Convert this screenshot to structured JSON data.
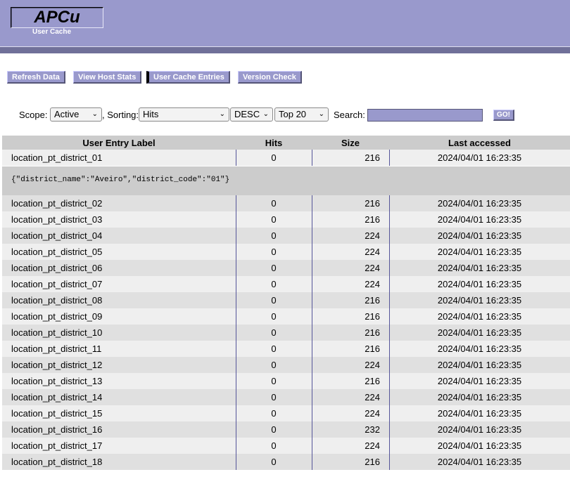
{
  "header": {
    "logo_title": "APCu",
    "logo_subtitle": "User Cache"
  },
  "menu": [
    {
      "label": "Refresh Data"
    },
    {
      "label": "View Host Stats"
    },
    {
      "label": "User Cache Entries"
    },
    {
      "label": "Version Check"
    }
  ],
  "filters": {
    "scope_label": "Scope:",
    "scope_value": "Active",
    "sorting_label": ", Sorting:",
    "sort_value": "Hits",
    "order_value": "DESC",
    "limit_value": "Top 20",
    "search_label": "Search:",
    "search_value": "",
    "go_label": "GO!"
  },
  "table": {
    "headers": [
      "User Entry Label",
      "Hits",
      "Size",
      "Last accessed"
    ],
    "detail": "{\"district_name\":\"Aveiro\",\"district_code\":\"01\"}",
    "rows": [
      [
        "location_pt_district_01",
        "0",
        "216",
        "2024/04/01 16:23:35"
      ],
      [
        "location_pt_district_02",
        "0",
        "216",
        "2024/04/01 16:23:35"
      ],
      [
        "location_pt_district_03",
        "0",
        "216",
        "2024/04/01 16:23:35"
      ],
      [
        "location_pt_district_04",
        "0",
        "224",
        "2024/04/01 16:23:35"
      ],
      [
        "location_pt_district_05",
        "0",
        "224",
        "2024/04/01 16:23:35"
      ],
      [
        "location_pt_district_06",
        "0",
        "224",
        "2024/04/01 16:23:35"
      ],
      [
        "location_pt_district_07",
        "0",
        "224",
        "2024/04/01 16:23:35"
      ],
      [
        "location_pt_district_08",
        "0",
        "216",
        "2024/04/01 16:23:35"
      ],
      [
        "location_pt_district_09",
        "0",
        "216",
        "2024/04/01 16:23:35"
      ],
      [
        "location_pt_district_10",
        "0",
        "216",
        "2024/04/01 16:23:35"
      ],
      [
        "location_pt_district_11",
        "0",
        "216",
        "2024/04/01 16:23:35"
      ],
      [
        "location_pt_district_12",
        "0",
        "224",
        "2024/04/01 16:23:35"
      ],
      [
        "location_pt_district_13",
        "0",
        "216",
        "2024/04/01 16:23:35"
      ],
      [
        "location_pt_district_14",
        "0",
        "224",
        "2024/04/01 16:23:35"
      ],
      [
        "location_pt_district_15",
        "0",
        "224",
        "2024/04/01 16:23:35"
      ],
      [
        "location_pt_district_16",
        "0",
        "232",
        "2024/04/01 16:23:35"
      ],
      [
        "location_pt_district_17",
        "0",
        "224",
        "2024/04/01 16:23:35"
      ],
      [
        "location_pt_district_18",
        "0",
        "216",
        "2024/04/01 16:23:35"
      ]
    ]
  }
}
